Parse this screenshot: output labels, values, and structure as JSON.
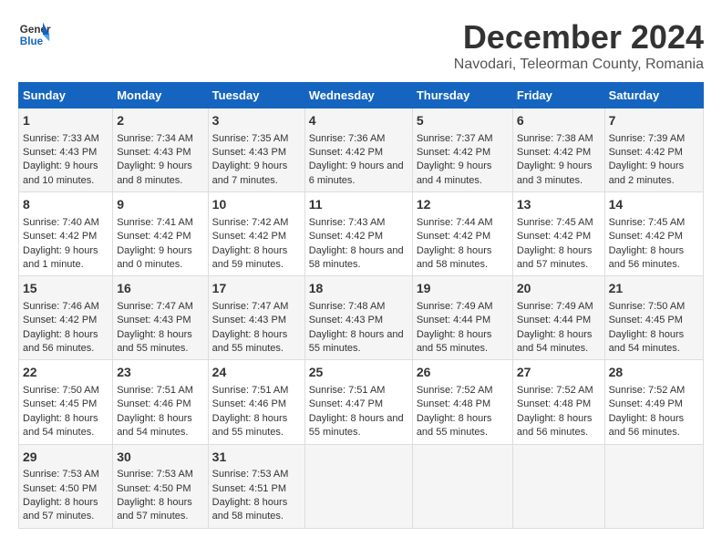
{
  "logo": {
    "line1": "General",
    "line2": "Blue"
  },
  "title": "December 2024",
  "subtitle": "Navodari, Teleorman County, Romania",
  "days_of_week": [
    "Sunday",
    "Monday",
    "Tuesday",
    "Wednesday",
    "Thursday",
    "Friday",
    "Saturday"
  ],
  "weeks": [
    [
      {
        "day": 1,
        "sunrise": "Sunrise: 7:33 AM",
        "sunset": "Sunset: 4:43 PM",
        "daylight": "Daylight: 9 hours and 10 minutes."
      },
      {
        "day": 2,
        "sunrise": "Sunrise: 7:34 AM",
        "sunset": "Sunset: 4:43 PM",
        "daylight": "Daylight: 9 hours and 8 minutes."
      },
      {
        "day": 3,
        "sunrise": "Sunrise: 7:35 AM",
        "sunset": "Sunset: 4:43 PM",
        "daylight": "Daylight: 9 hours and 7 minutes."
      },
      {
        "day": 4,
        "sunrise": "Sunrise: 7:36 AM",
        "sunset": "Sunset: 4:42 PM",
        "daylight": "Daylight: 9 hours and 6 minutes."
      },
      {
        "day": 5,
        "sunrise": "Sunrise: 7:37 AM",
        "sunset": "Sunset: 4:42 PM",
        "daylight": "Daylight: 9 hours and 4 minutes."
      },
      {
        "day": 6,
        "sunrise": "Sunrise: 7:38 AM",
        "sunset": "Sunset: 4:42 PM",
        "daylight": "Daylight: 9 hours and 3 minutes."
      },
      {
        "day": 7,
        "sunrise": "Sunrise: 7:39 AM",
        "sunset": "Sunset: 4:42 PM",
        "daylight": "Daylight: 9 hours and 2 minutes."
      }
    ],
    [
      {
        "day": 8,
        "sunrise": "Sunrise: 7:40 AM",
        "sunset": "Sunset: 4:42 PM",
        "daylight": "Daylight: 9 hours and 1 minute."
      },
      {
        "day": 9,
        "sunrise": "Sunrise: 7:41 AM",
        "sunset": "Sunset: 4:42 PM",
        "daylight": "Daylight: 9 hours and 0 minutes."
      },
      {
        "day": 10,
        "sunrise": "Sunrise: 7:42 AM",
        "sunset": "Sunset: 4:42 PM",
        "daylight": "Daylight: 8 hours and 59 minutes."
      },
      {
        "day": 11,
        "sunrise": "Sunrise: 7:43 AM",
        "sunset": "Sunset: 4:42 PM",
        "daylight": "Daylight: 8 hours and 58 minutes."
      },
      {
        "day": 12,
        "sunrise": "Sunrise: 7:44 AM",
        "sunset": "Sunset: 4:42 PM",
        "daylight": "Daylight: 8 hours and 58 minutes."
      },
      {
        "day": 13,
        "sunrise": "Sunrise: 7:45 AM",
        "sunset": "Sunset: 4:42 PM",
        "daylight": "Daylight: 8 hours and 57 minutes."
      },
      {
        "day": 14,
        "sunrise": "Sunrise: 7:45 AM",
        "sunset": "Sunset: 4:42 PM",
        "daylight": "Daylight: 8 hours and 56 minutes."
      }
    ],
    [
      {
        "day": 15,
        "sunrise": "Sunrise: 7:46 AM",
        "sunset": "Sunset: 4:42 PM",
        "daylight": "Daylight: 8 hours and 56 minutes."
      },
      {
        "day": 16,
        "sunrise": "Sunrise: 7:47 AM",
        "sunset": "Sunset: 4:43 PM",
        "daylight": "Daylight: 8 hours and 55 minutes."
      },
      {
        "day": 17,
        "sunrise": "Sunrise: 7:47 AM",
        "sunset": "Sunset: 4:43 PM",
        "daylight": "Daylight: 8 hours and 55 minutes."
      },
      {
        "day": 18,
        "sunrise": "Sunrise: 7:48 AM",
        "sunset": "Sunset: 4:43 PM",
        "daylight": "Daylight: 8 hours and 55 minutes."
      },
      {
        "day": 19,
        "sunrise": "Sunrise: 7:49 AM",
        "sunset": "Sunset: 4:44 PM",
        "daylight": "Daylight: 8 hours and 55 minutes."
      },
      {
        "day": 20,
        "sunrise": "Sunrise: 7:49 AM",
        "sunset": "Sunset: 4:44 PM",
        "daylight": "Daylight: 8 hours and 54 minutes."
      },
      {
        "day": 21,
        "sunrise": "Sunrise: 7:50 AM",
        "sunset": "Sunset: 4:45 PM",
        "daylight": "Daylight: 8 hours and 54 minutes."
      }
    ],
    [
      {
        "day": 22,
        "sunrise": "Sunrise: 7:50 AM",
        "sunset": "Sunset: 4:45 PM",
        "daylight": "Daylight: 8 hours and 54 minutes."
      },
      {
        "day": 23,
        "sunrise": "Sunrise: 7:51 AM",
        "sunset": "Sunset: 4:46 PM",
        "daylight": "Daylight: 8 hours and 54 minutes."
      },
      {
        "day": 24,
        "sunrise": "Sunrise: 7:51 AM",
        "sunset": "Sunset: 4:46 PM",
        "daylight": "Daylight: 8 hours and 55 minutes."
      },
      {
        "day": 25,
        "sunrise": "Sunrise: 7:51 AM",
        "sunset": "Sunset: 4:47 PM",
        "daylight": "Daylight: 8 hours and 55 minutes."
      },
      {
        "day": 26,
        "sunrise": "Sunrise: 7:52 AM",
        "sunset": "Sunset: 4:48 PM",
        "daylight": "Daylight: 8 hours and 55 minutes."
      },
      {
        "day": 27,
        "sunrise": "Sunrise: 7:52 AM",
        "sunset": "Sunset: 4:48 PM",
        "daylight": "Daylight: 8 hours and 56 minutes."
      },
      {
        "day": 28,
        "sunrise": "Sunrise: 7:52 AM",
        "sunset": "Sunset: 4:49 PM",
        "daylight": "Daylight: 8 hours and 56 minutes."
      }
    ],
    [
      {
        "day": 29,
        "sunrise": "Sunrise: 7:53 AM",
        "sunset": "Sunset: 4:50 PM",
        "daylight": "Daylight: 8 hours and 57 minutes."
      },
      {
        "day": 30,
        "sunrise": "Sunrise: 7:53 AM",
        "sunset": "Sunset: 4:50 PM",
        "daylight": "Daylight: 8 hours and 57 minutes."
      },
      {
        "day": 31,
        "sunrise": "Sunrise: 7:53 AM",
        "sunset": "Sunset: 4:51 PM",
        "daylight": "Daylight: 8 hours and 58 minutes."
      },
      null,
      null,
      null,
      null
    ]
  ]
}
